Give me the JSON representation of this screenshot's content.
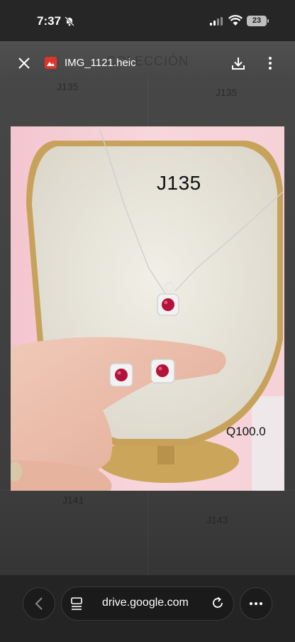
{
  "status_bar": {
    "time": "7:37",
    "battery": "23"
  },
  "viewer": {
    "file_name": "IMG_1121.heic",
    "close_icon": "close-icon",
    "download_icon": "download-icon",
    "more_icon": "more-vertical-icon"
  },
  "background_labels": {
    "header_word": "COLECCIÓN",
    "codes": [
      "J135",
      "J135",
      "J141",
      "J143"
    ]
  },
  "photo": {
    "product_code": "J135",
    "price": "Q100.0"
  },
  "browser": {
    "url": "drive.google.com",
    "back_icon": "chevron-left-icon",
    "tabs_icon": "tabs-icon",
    "reload_icon": "reload-icon",
    "menu_icon": "more-horizontal-icon"
  },
  "colors": {
    "accent_red": "#e0342b",
    "ruby": "#b3123a"
  }
}
